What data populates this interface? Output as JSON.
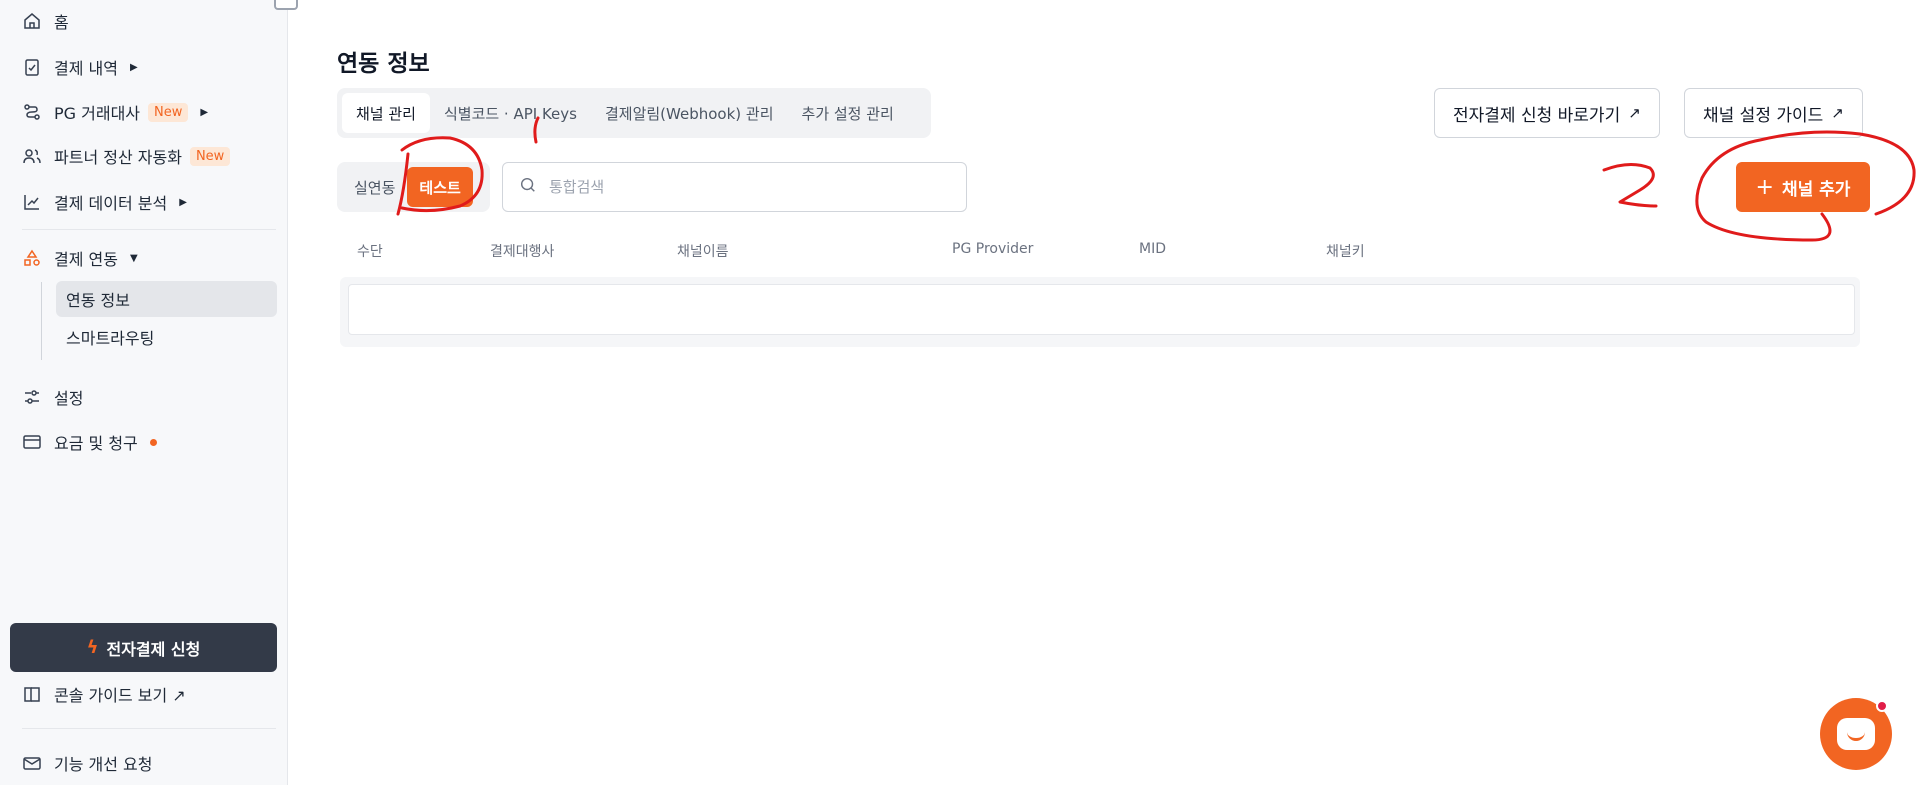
{
  "sidebar": {
    "items": [
      {
        "label": "홈"
      },
      {
        "label": "결제 내역"
      },
      {
        "label": "PG 거래대사",
        "badge": "New"
      },
      {
        "label": "파트너 정산 자동화",
        "badge": "New"
      },
      {
        "label": "결제 데이터 분석"
      },
      {
        "label": "결제 연동"
      },
      {
        "label": "설정"
      },
      {
        "label": "요금 및 청구"
      }
    ],
    "sub_items": [
      {
        "label": "연동 정보"
      },
      {
        "label": "스마트라우팅"
      }
    ],
    "apply_button": "전자결제 신청",
    "console_guide": "콘솔 가이드 보기 ↗",
    "feature_request": "기능 개선 요청"
  },
  "main": {
    "title": "연동 정보",
    "tabs": [
      {
        "label": "채널 관리"
      },
      {
        "label": "식별코드 · API Keys"
      },
      {
        "label": "결제알림(Webhook) 관리"
      },
      {
        "label": "추가 설정 관리"
      }
    ],
    "link_apply": "전자결제 신청 바로가기",
    "link_guide": "채널 설정 가이드",
    "mode_live": "실연동",
    "mode_test": "테스트",
    "search_placeholder": "통합검색",
    "add_channel": "채널 추가",
    "columns": [
      "수단",
      "결제대행사",
      "채널이름",
      "PG Provider",
      "MID",
      "채널키"
    ]
  },
  "colors": {
    "accent": "#f26522",
    "dark_button": "#333a48",
    "annotation": "#e01b1b"
  }
}
